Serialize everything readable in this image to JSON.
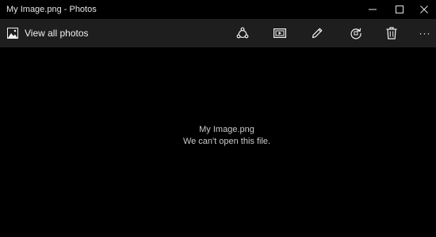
{
  "window": {
    "title": "My Image.png - Photos",
    "controls": {
      "minimize_icon": "minimize-icon",
      "maximize_icon": "maximize-icon",
      "close_icon": "close-icon"
    }
  },
  "toolbar": {
    "view_all_label": "View all photos",
    "view_all_icon": "photo-icon",
    "tools": [
      {
        "icon": "share-icon"
      },
      {
        "icon": "slideshow-icon"
      },
      {
        "icon": "edit-icon"
      },
      {
        "icon": "rotate-icon"
      },
      {
        "icon": "delete-icon"
      },
      {
        "icon": "more-icon",
        "glyph": "···"
      }
    ]
  },
  "content": {
    "filename": "My Image.png",
    "error_message": "We can't open this file."
  },
  "colors": {
    "background": "#000000",
    "toolbar_background": "#1e1e1e",
    "accent": "#2b8fd6",
    "text": "#f0f0f0",
    "message_text": "#c8c8c8"
  }
}
